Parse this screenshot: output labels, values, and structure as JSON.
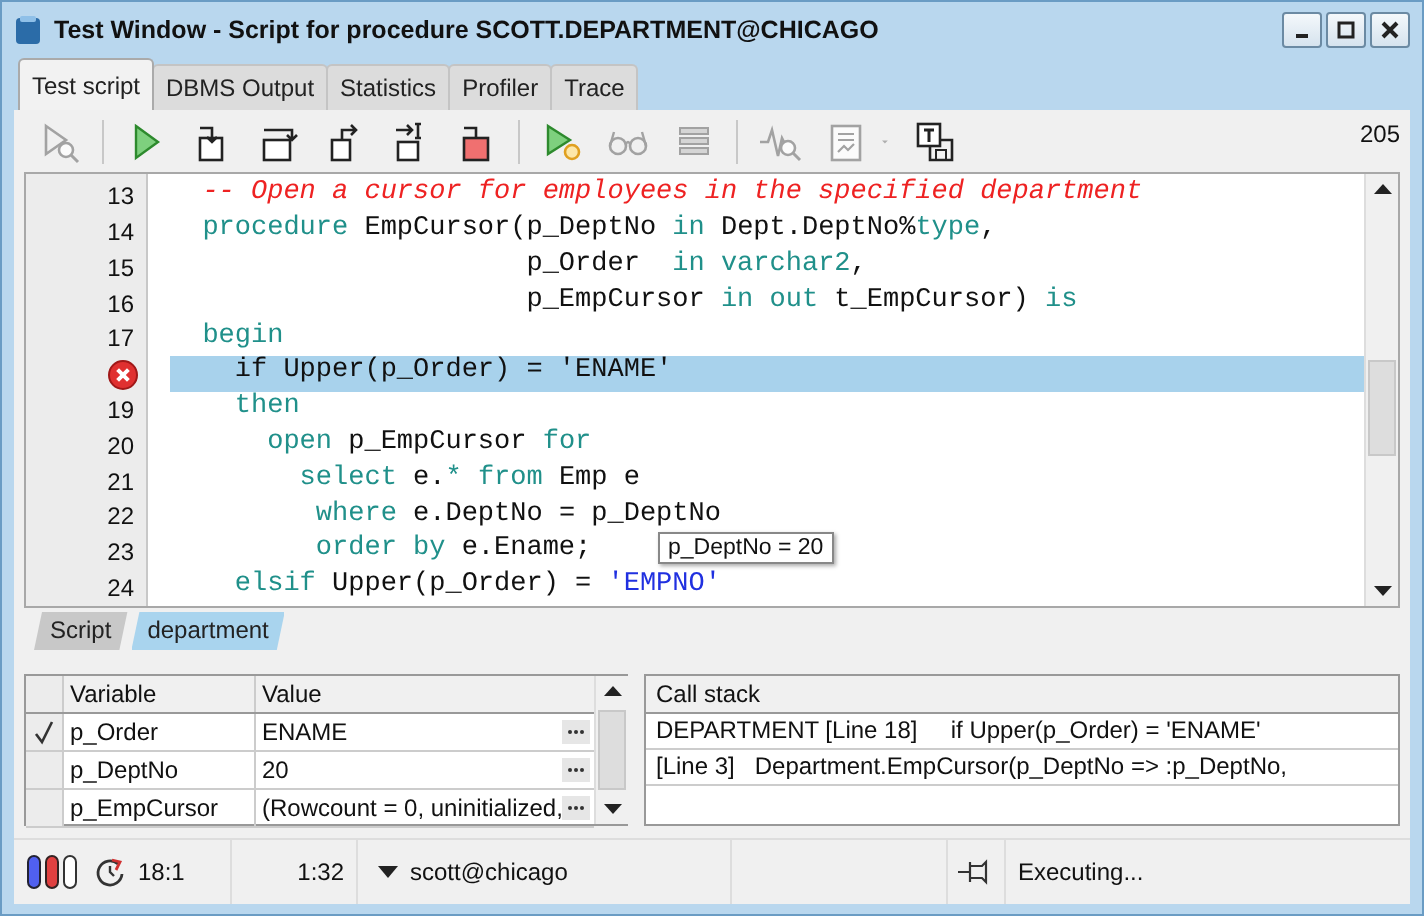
{
  "window": {
    "title": "Test Window - Script for procedure SCOTT.DEPARTMENT@CHICAGO"
  },
  "tabs": [
    {
      "label": "Test script",
      "selected": true
    },
    {
      "label": "DBMS Output",
      "selected": false
    },
    {
      "label": "Statistics",
      "selected": false
    },
    {
      "label": "Profiler",
      "selected": false
    },
    {
      "label": "Trace",
      "selected": false
    }
  ],
  "toolbar": {
    "groups": [
      [
        {
          "kind": "find",
          "disabled": true
        }
      ],
      [
        {
          "kind": "run",
          "disabled": false
        },
        {
          "kind": "step-into",
          "disabled": false
        },
        {
          "kind": "step-over",
          "disabled": false
        },
        {
          "kind": "step-out",
          "disabled": false
        },
        {
          "kind": "run-to-cursor",
          "disabled": false
        },
        {
          "kind": "stop",
          "disabled": false
        }
      ],
      [
        {
          "kind": "run-options",
          "disabled": false
        },
        {
          "kind": "glasses",
          "disabled": true
        },
        {
          "kind": "stack",
          "disabled": true
        }
      ],
      [
        {
          "kind": "wave",
          "disabled": true
        },
        {
          "kind": "report",
          "disabled": true
        },
        {
          "kind": "caret",
          "disabled": true
        },
        {
          "kind": "save-text",
          "disabled": false
        }
      ]
    ],
    "counter": "205"
  },
  "editor": {
    "lines": [
      {
        "number": "13",
        "breakpoint": false,
        "selected": false,
        "tokens": [
          {
            "t": "  -- Open a cursor for employees in the specified department",
            "kind": "comment"
          }
        ]
      },
      {
        "number": "14",
        "breakpoint": false,
        "selected": false,
        "tokens": [
          {
            "t": "  procedure ",
            "kind": "keyword"
          },
          {
            "t": "EmpCursor(p_DeptNo ",
            "kind": "plain"
          },
          {
            "t": "in ",
            "kind": "keyword"
          },
          {
            "t": "Dept.DeptNo%",
            "kind": "plain"
          },
          {
            "t": "type",
            "kind": "keyword"
          },
          {
            "t": ",",
            "kind": "plain"
          }
        ]
      },
      {
        "number": "15",
        "breakpoint": false,
        "selected": false,
        "tokens": [
          {
            "t": "                      p_Order  ",
            "kind": "plain"
          },
          {
            "t": "in varchar2",
            "kind": "keyword"
          },
          {
            "t": ",",
            "kind": "plain"
          }
        ]
      },
      {
        "number": "16",
        "breakpoint": false,
        "selected": false,
        "tokens": [
          {
            "t": "                      p_EmpCursor ",
            "kind": "plain"
          },
          {
            "t": "in out ",
            "kind": "keyword"
          },
          {
            "t": "t_EmpCursor) ",
            "kind": "plain"
          },
          {
            "t": "is",
            "kind": "keyword"
          }
        ]
      },
      {
        "number": "17",
        "breakpoint": false,
        "selected": false,
        "tokens": [
          {
            "t": "  begin",
            "kind": "keyword"
          }
        ]
      },
      {
        "breakpoint": true,
        "selected": true,
        "tokens": [
          {
            "t": "    if Upper(p_Order) = 'ENAME'",
            "kind": "plain"
          }
        ]
      },
      {
        "number": "19",
        "breakpoint": false,
        "selected": false,
        "tokens": [
          {
            "t": "    then",
            "kind": "keyword"
          }
        ]
      },
      {
        "number": "20",
        "breakpoint": false,
        "selected": false,
        "tokens": [
          {
            "t": "      open ",
            "kind": "keyword"
          },
          {
            "t": "p_EmpCursor ",
            "kind": "plain"
          },
          {
            "t": "for",
            "kind": "keyword"
          }
        ]
      },
      {
        "number": "21",
        "breakpoint": false,
        "selected": false,
        "tokens": [
          {
            "t": "        select ",
            "kind": "keyword"
          },
          {
            "t": "e.",
            "kind": "plain"
          },
          {
            "t": "* ",
            "kind": "keyword"
          },
          {
            "t": "from ",
            "kind": "keyword"
          },
          {
            "t": "Emp e",
            "kind": "plain"
          }
        ]
      },
      {
        "number": "22",
        "breakpoint": false,
        "selected": false,
        "tokens": [
          {
            "t": "         where ",
            "kind": "keyword"
          },
          {
            "t": "e.DeptNo = p_DeptNo",
            "kind": "plain"
          }
        ]
      },
      {
        "number": "23",
        "breakpoint": false,
        "selected": false,
        "tokens": [
          {
            "t": "         order by ",
            "kind": "keyword"
          },
          {
            "t": "e.Ename;",
            "kind": "plain"
          }
        ]
      },
      {
        "number": "24",
        "breakpoint": false,
        "selected": false,
        "tokens": [
          {
            "t": "    elsif ",
            "kind": "keyword"
          },
          {
            "t": "Upper(p_Order) = ",
            "kind": "plain"
          },
          {
            "t": "'EMPNO'",
            "kind": "string"
          }
        ]
      }
    ],
    "tooltip": "p_DeptNo = 20"
  },
  "script_tabs": [
    {
      "label": "Script",
      "selected": false
    },
    {
      "label": "department",
      "selected": true
    }
  ],
  "variables": {
    "columns": [
      "Variable",
      "Value"
    ],
    "rows": [
      {
        "checked": true,
        "name": "p_Order",
        "value": "ENAME"
      },
      {
        "checked": false,
        "name": "p_DeptNo",
        "value": "20"
      },
      {
        "checked": false,
        "name": "p_EmpCursor",
        "value": "(Rowcount = 0, uninitialized,"
      }
    ]
  },
  "call_stack": {
    "heading": "Call stack",
    "rows": [
      "DEPARTMENT [Line 18]     if Upper(p_Order) = 'ENAME'",
      "[Line 3]   Department.EmpCursor(p_DeptNo => :p_DeptNo,"
    ]
  },
  "status_bar": {
    "position": "18:1",
    "time": "1:32",
    "connection": "scott@chicago",
    "state": "Executing..."
  }
}
